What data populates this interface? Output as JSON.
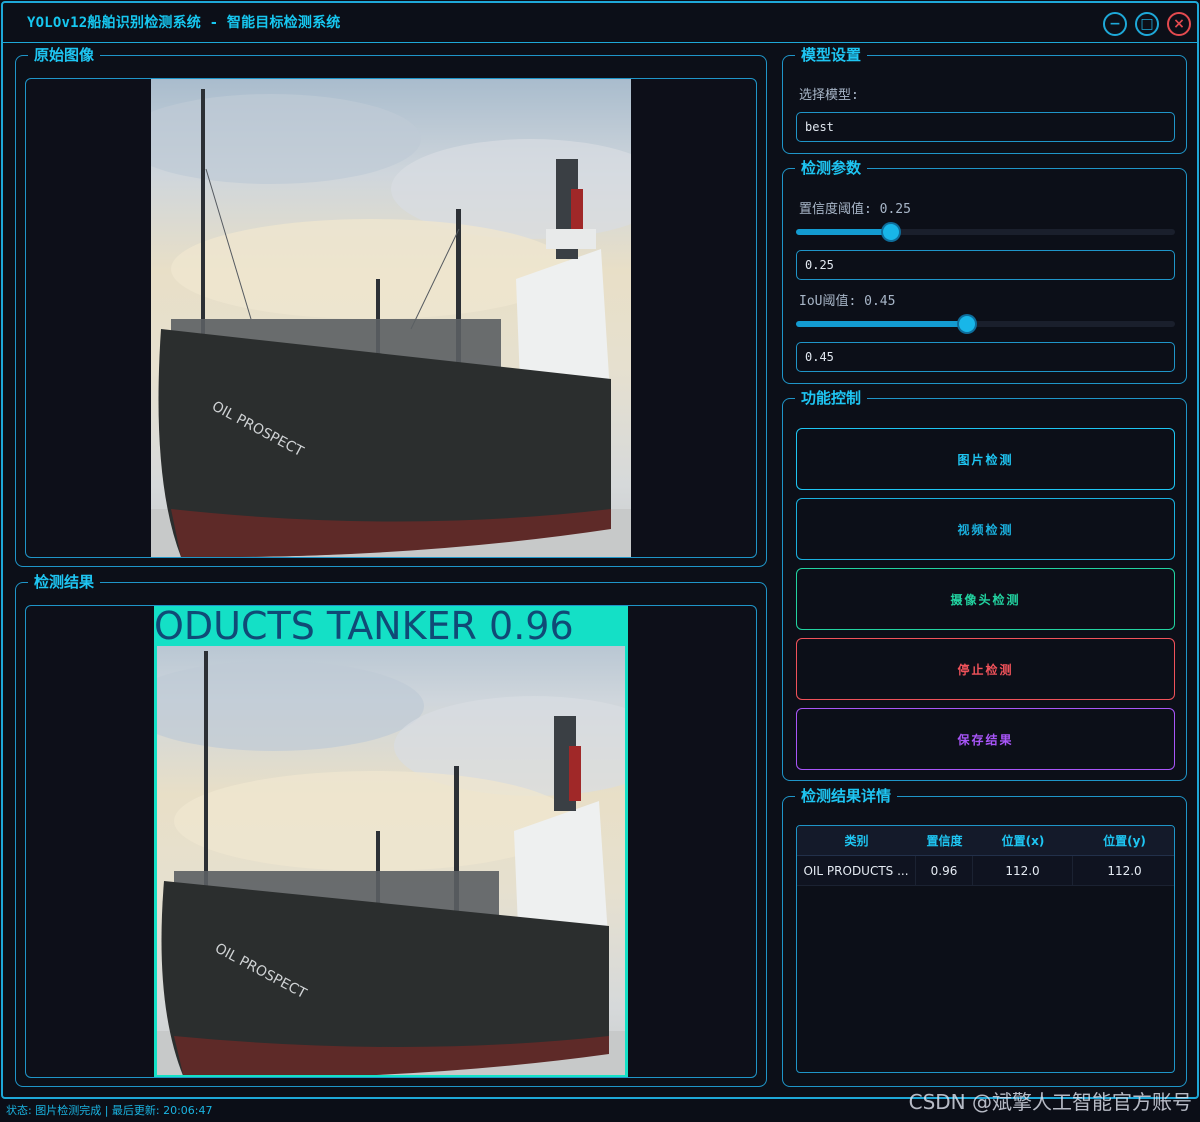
{
  "window": {
    "title": "YOLOv12船舶识别检测系统 - 智能目标检测系统",
    "minimize_symbol": "−",
    "maximize_symbol": "□",
    "close_symbol": "×"
  },
  "panels": {
    "original": {
      "title": "原始图像"
    },
    "result": {
      "title": "检测结果",
      "detection_label": "ODUCTS TANKER 0.96"
    }
  },
  "model_settings": {
    "title": "模型设置",
    "select_label": "选择模型:",
    "model_value": "best"
  },
  "detection_params": {
    "title": "检测参数",
    "confidence_label": "置信度阈值: 0.25",
    "confidence_value": "0.25",
    "confidence_level": 0.25,
    "iou_label": "IoU阈值: 0.45",
    "iou_value": "0.45",
    "iou_level": 0.45
  },
  "controls": {
    "title": "功能控制",
    "buttons": [
      {
        "label": "图片检测",
        "color": "#1ec5f2"
      },
      {
        "label": "视频检测",
        "color": "#1ab0de"
      },
      {
        "label": "摄像头检测",
        "color": "#22d3a0"
      },
      {
        "label": "停止检测",
        "color": "#f0525a"
      },
      {
        "label": "保存结果",
        "color": "#a855f7"
      }
    ]
  },
  "results_table": {
    "title": "检测结果详情",
    "headers": [
      "类别",
      "置信度",
      "位置(x)",
      "位置(y)"
    ],
    "rows": [
      {
        "class": "OIL PRODUCTS ...",
        "confidence": "0.96",
        "x": "112.0",
        "y": "112.0"
      }
    ]
  },
  "status": {
    "text": "状态: 图片检测完成 | 最后更新: 20:06:47"
  },
  "watermark": "CSDN @斌擎人工智能官方账号",
  "colors": {
    "accent": "#1ea8d8",
    "detection_box": "#14e0c6"
  }
}
